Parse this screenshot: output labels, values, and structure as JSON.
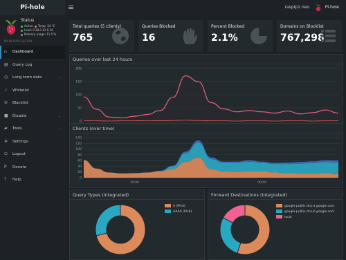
{
  "app": {
    "brand": "Pi-hole",
    "menu_icon": "hamburger-icon"
  },
  "topbar": {
    "hostname": "raspip1.neo",
    "user_label": "Pi-hole"
  },
  "status": {
    "title": "Status",
    "active": "Active",
    "temp": "Temp: 34 °C",
    "load": "Load: 0.18 0.12 0.14",
    "memory": "Memory usage: 11.5 %"
  },
  "nav": {
    "header": "MAIN NAVIGATION",
    "items": [
      {
        "label": "Dashboard",
        "icon": "home-icon",
        "glyph": "⌂",
        "chevron": ""
      },
      {
        "label": "Query Log",
        "icon": "file-icon",
        "glyph": "▤",
        "chevron": ""
      },
      {
        "label": "Long term data",
        "icon": "clock-icon",
        "glyph": "◷",
        "chevron": "⌄"
      },
      {
        "label": "Whitelist",
        "icon": "check-circle-icon",
        "glyph": "✓",
        "chevron": ""
      },
      {
        "label": "Blacklist",
        "icon": "ban-icon",
        "glyph": "⊘",
        "chevron": ""
      },
      {
        "label": "Disable",
        "icon": "stop-icon",
        "glyph": "■",
        "chevron": "⌄"
      },
      {
        "label": "Tools",
        "icon": "folder-icon",
        "glyph": "▰",
        "chevron": "⌄"
      },
      {
        "label": "Settings",
        "icon": "gears-icon",
        "glyph": "✲",
        "chevron": ""
      },
      {
        "label": "Logout",
        "icon": "power-icon",
        "glyph": "⏻",
        "chevron": ""
      },
      {
        "label": "Donate",
        "icon": "paypal-icon",
        "glyph": "P",
        "chevron": ""
      },
      {
        "label": "Help",
        "icon": "question-icon",
        "glyph": "?",
        "chevron": ""
      }
    ]
  },
  "stats": [
    {
      "label": "Total queries (5 clients)",
      "value": "765",
      "icon": "globe-icon",
      "color": "#232a2e"
    },
    {
      "label": "Queries Blocked",
      "value": "16",
      "icon": "hand-icon",
      "color": "#232a2e"
    },
    {
      "label": "Percent Blocked",
      "value": "2.1%",
      "icon": "pie-icon",
      "color": "#232a2e"
    },
    {
      "label": "Domains on Blocklist",
      "value": "767,298",
      "icon": "list-icon",
      "color": "#232a2e"
    }
  ],
  "colors": {
    "queries_line": "#e8607e",
    "blocked_line": "#d9534f",
    "ipv4": "#dc8a5c",
    "ipv6": "#2aa8c2",
    "dest1": "#dc8a5c",
    "dest2": "#2aa8c2",
    "dest3": "#f06292",
    "client_blue": "#3f6fc4",
    "grid": "#383f43"
  },
  "panels": {
    "queries_title": "Queries over last 24 hours",
    "clients_title": "Clients (over time)",
    "query_types_title": "Query Types (integrated)",
    "forward_title": "Forward Destinations (integrated)"
  },
  "chart_data": [
    {
      "type": "line",
      "title": "Queries over last 24 hours",
      "y_ticks": [
        "0",
        "50",
        "100",
        "150",
        "200"
      ],
      "x_ticks": [
        "20:00",
        "00:00"
      ],
      "ylim": [
        0,
        200
      ],
      "series": [
        {
          "values": [
            92,
            45,
            15,
            12,
            18,
            25,
            40,
            90,
            172,
            150,
            70,
            46,
            35,
            40,
            35,
            30,
            38,
            27,
            32,
            42,
            30
          ]
        },
        {
          "values": [
            1,
            1,
            0,
            1,
            1,
            2,
            1,
            2,
            3,
            2,
            1,
            1,
            0,
            1,
            1,
            0,
            1,
            1,
            0,
            1,
            1
          ]
        }
      ]
    },
    {
      "type": "area",
      "title": "Clients (over time)",
      "y_ticks": [
        "0",
        "20",
        "40",
        "60",
        "80",
        "100",
        "120",
        "140"
      ],
      "x_ticks": [
        "20:00",
        "00:00"
      ],
      "ylim": [
        0,
        140
      ],
      "series": [
        {
          "values": [
            62,
            32,
            18,
            15,
            16,
            18,
            22,
            30,
            55,
            70,
            30,
            22,
            20,
            22,
            22,
            18,
            16,
            15,
            15,
            16,
            12
          ]
        },
        {
          "values": [
            0,
            0,
            0,
            0,
            0,
            0,
            2,
            10,
            30,
            52,
            35,
            30,
            32,
            34,
            30,
            30,
            32,
            34,
            36,
            38,
            40
          ]
        },
        {
          "values": [
            0,
            0,
            0,
            0,
            0,
            0,
            0,
            2,
            6,
            8,
            6,
            4,
            4,
            5,
            4,
            4,
            5,
            6,
            6,
            7,
            8
          ]
        }
      ]
    },
    {
      "type": "pie",
      "title": "Query Types (integrated)",
      "labels": [
        "A (IPv4)",
        "AAAA (IPv6)"
      ],
      "values": [
        71,
        29
      ]
    },
    {
      "type": "pie",
      "title": "Forward Destinations (integrated)",
      "labels": [
        "google-public-dns-a.google.com",
        "google-public-dns-b.google.com",
        "local"
      ],
      "values": [
        55,
        28,
        17
      ]
    }
  ]
}
